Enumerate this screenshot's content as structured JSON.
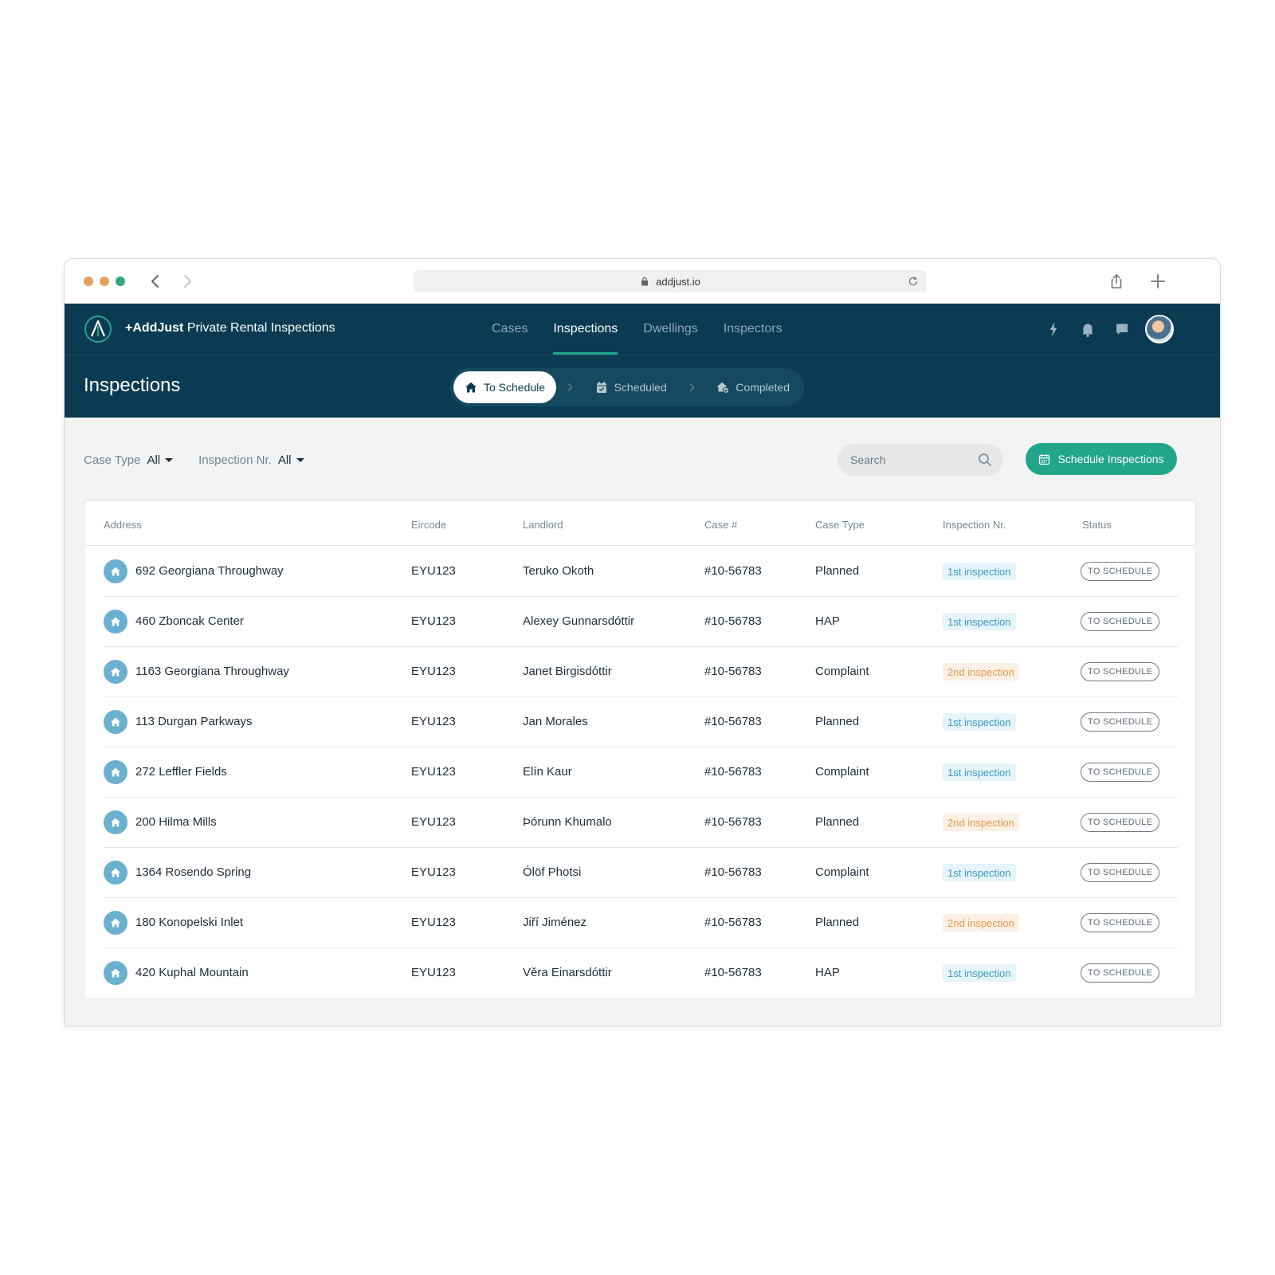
{
  "browser": {
    "url": "addjust.io"
  },
  "app": {
    "brand_bold": "+AddJust",
    "brand_rest": " Private Rental Inspections",
    "nav": [
      {
        "label": "Cases"
      },
      {
        "label": "Inspections"
      },
      {
        "label": "Dwellings"
      },
      {
        "label": "Inspectors"
      }
    ],
    "active_nav": "Inspections"
  },
  "page": {
    "title": "Inspections",
    "steps": [
      {
        "label": "To Schedule",
        "icon": "home-icon",
        "active": true
      },
      {
        "label": "Scheduled",
        "icon": "calendar-check-icon",
        "active": false
      },
      {
        "label": "Completed",
        "icon": "home-check-icon",
        "active": false
      }
    ]
  },
  "filters": {
    "case_type": {
      "label": "Case Type",
      "value": "All"
    },
    "inspection_nr": {
      "label": "Inspection Nr.",
      "value": "All"
    }
  },
  "search": {
    "placeholder": "Search"
  },
  "actions": {
    "schedule_label": "Schedule Inspections"
  },
  "table": {
    "columns": [
      "Address",
      "Eircode",
      "Landlord",
      "Case #",
      "Case Type",
      "Inspection Nr.",
      "Status"
    ],
    "rows": [
      {
        "address": "692 Georgiana Throughway",
        "eircode": "EYU123",
        "landlord": "Teruko Okoth",
        "case": "#10-56783",
        "case_type": "Planned",
        "inspection": "1st inspection",
        "inspection_kind": "first",
        "status": "TO SCHEDULE"
      },
      {
        "address": "460 Zboncak Center",
        "eircode": "EYU123",
        "landlord": "Alexey Gunnarsdóttir",
        "case": "#10-56783",
        "case_type": "HAP",
        "inspection": "1st inspection",
        "inspection_kind": "first",
        "status": "TO SCHEDULE"
      },
      {
        "address": "1163 Georgiana Throughway",
        "eircode": "EYU123",
        "landlord": "Janet Birgisdóttir",
        "case": "#10-56783",
        "case_type": "Complaint",
        "inspection": "2nd inspection",
        "inspection_kind": "second",
        "status": "TO SCHEDULE"
      },
      {
        "address": "113 Durgan Parkways",
        "eircode": "EYU123",
        "landlord": "Jan Morales",
        "case": "#10-56783",
        "case_type": "Planned",
        "inspection": "1st inspection",
        "inspection_kind": "first",
        "status": "TO SCHEDULE"
      },
      {
        "address": "272 Leffler Fields",
        "eircode": "EYU123",
        "landlord": "Elín Kaur",
        "case": "#10-56783",
        "case_type": "Complaint",
        "inspection": "1st inspection",
        "inspection_kind": "first",
        "status": "TO SCHEDULE"
      },
      {
        "address": "200 Hilma Mills",
        "eircode": "EYU123",
        "landlord": "Þórunn Khumalo",
        "case": "#10-56783",
        "case_type": "Planned",
        "inspection": "2nd inspection",
        "inspection_kind": "second",
        "status": "TO SCHEDULE"
      },
      {
        "address": "1364 Rosendo Spring",
        "eircode": "EYU123",
        "landlord": "Ólöf Photsi",
        "case": "#10-56783",
        "case_type": "Complaint",
        "inspection": "1st inspection",
        "inspection_kind": "first",
        "status": "TO SCHEDULE"
      },
      {
        "address": "180 Konopelski Inlet",
        "eircode": "EYU123",
        "landlord": "Jiří Jiménez",
        "case": "#10-56783",
        "case_type": "Planned",
        "inspection": "2nd inspection",
        "inspection_kind": "second",
        "status": "TO SCHEDULE"
      },
      {
        "address": "420 Kuphal Mountain",
        "eircode": "EYU123",
        "landlord": "Věra Einarsdóttir",
        "case": "#10-56783",
        "case_type": "HAP",
        "inspection": "1st inspection",
        "inspection_kind": "first",
        "status": "TO SCHEDULE"
      }
    ]
  },
  "colors": {
    "header_bg": "#0b3b53",
    "accent": "#23a58c",
    "first_badge": "#3a9ac6",
    "second_badge": "#e09a4f",
    "address_icon": "#6bb0cf"
  }
}
